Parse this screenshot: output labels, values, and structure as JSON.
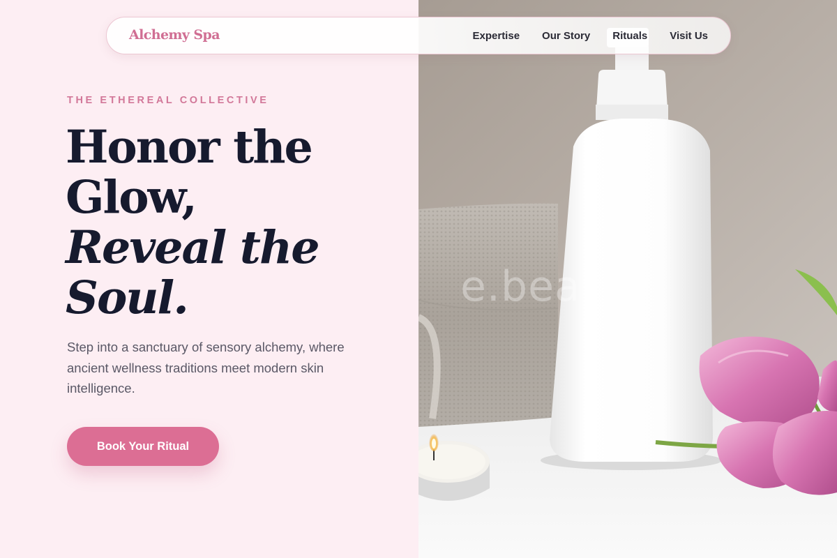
{
  "brand": {
    "name": "Alchemy Spa"
  },
  "nav": {
    "links": [
      {
        "label": "Expertise"
      },
      {
        "label": "Our Story"
      },
      {
        "label": "Rituals"
      },
      {
        "label": "Visit Us"
      }
    ]
  },
  "hero": {
    "eyebrow": "THE ETHEREAL COLLECTIVE",
    "headline": {
      "line1": "Honor the",
      "line2": "Glow,",
      "line3": "Reveal the",
      "line4": "Soul."
    },
    "description": "Step into a sanctuary of sensory alchemy, where ancient wellness traditions meet modern skin intelligence.",
    "cta_label": "Book Your Ritual"
  },
  "image": {
    "alt": "White lotion bottle, folded towel, tea-light candle and pink tulips",
    "watermark": "e.beauty"
  },
  "colors": {
    "accent": "#dc6e94",
    "brand": "#d06e93",
    "eyebrow": "#d27899",
    "heading": "#161a2e",
    "body_text": "#5a5866",
    "left_background": "#fdeef3"
  },
  "icons": []
}
